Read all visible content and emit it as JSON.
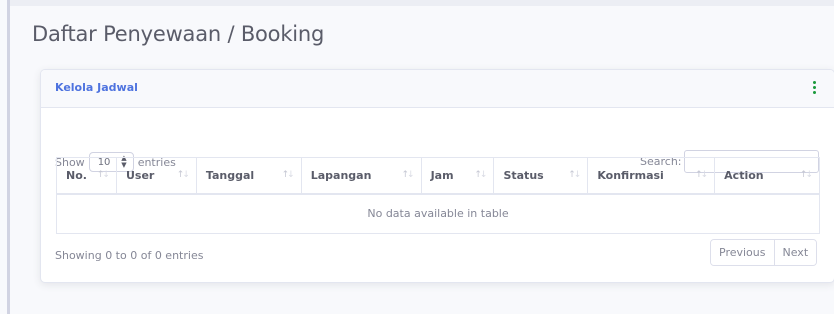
{
  "page": {
    "title": "Daftar Penyewaan / Booking"
  },
  "card": {
    "title": "Kelola Jadwal",
    "menu_icon": "kebab-vertical-icon",
    "accent_color": "#4e73df",
    "menu_color": "#1a9a3c"
  },
  "table_controls": {
    "show_label": "Show",
    "length_value": "10",
    "entries_label": "entries",
    "search_label": "Search:",
    "search_value": ""
  },
  "table": {
    "columns": [
      {
        "label": "No."
      },
      {
        "label": "User"
      },
      {
        "label": "Tanggal"
      },
      {
        "label": "Lapangan"
      },
      {
        "label": "Jam"
      },
      {
        "label": "Status"
      },
      {
        "label": "Konfirmasi"
      },
      {
        "label": "Action"
      }
    ],
    "empty_message": "No data available in table"
  },
  "footer": {
    "info": "Showing 0 to 0 of 0 entries",
    "previous_label": "Previous",
    "next_label": "Next"
  }
}
